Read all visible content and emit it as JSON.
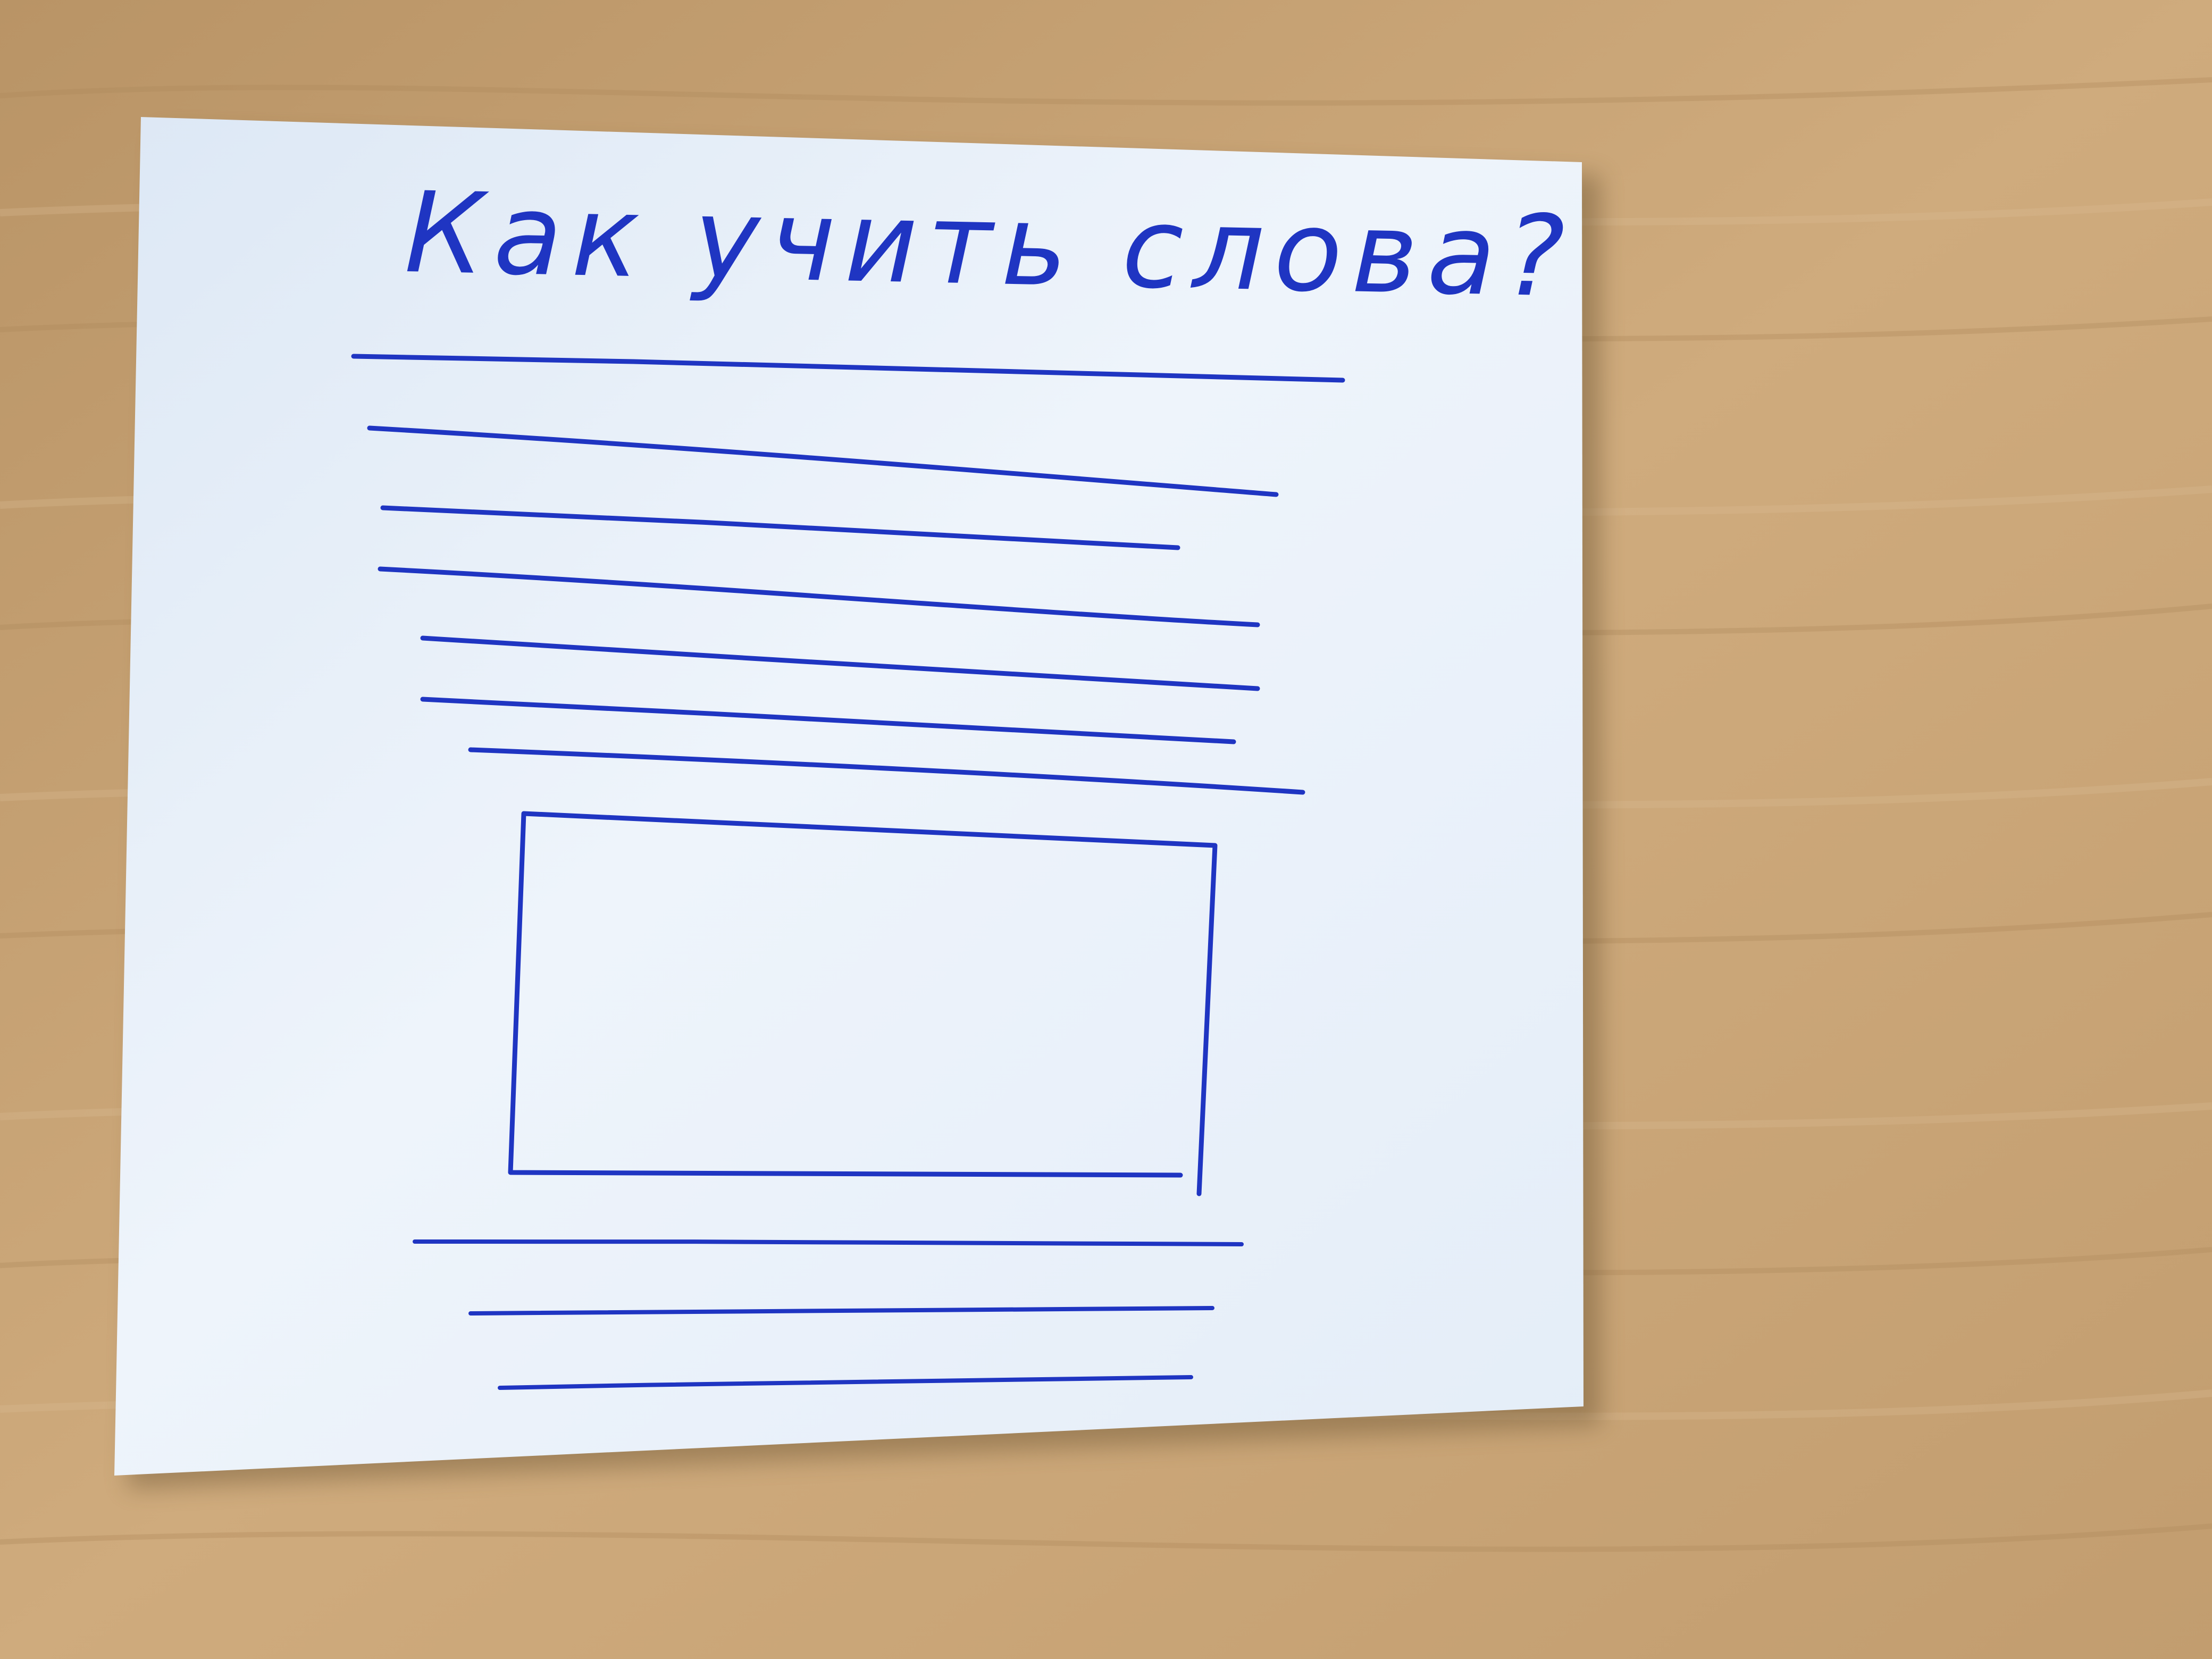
{
  "scene": {
    "description_type": "photo of a hand-drawn paper sketch on a wooden table",
    "colors": {
      "table": "#c9a67a",
      "table_grain_dark": "#b08a5c",
      "table_grain_light": "#d8b890",
      "paper": "#e8f0f9",
      "paper_shade": "#d6e2f0",
      "ink": "#1f35c2"
    }
  },
  "sketch": {
    "title": "Как учить слова?"
  }
}
